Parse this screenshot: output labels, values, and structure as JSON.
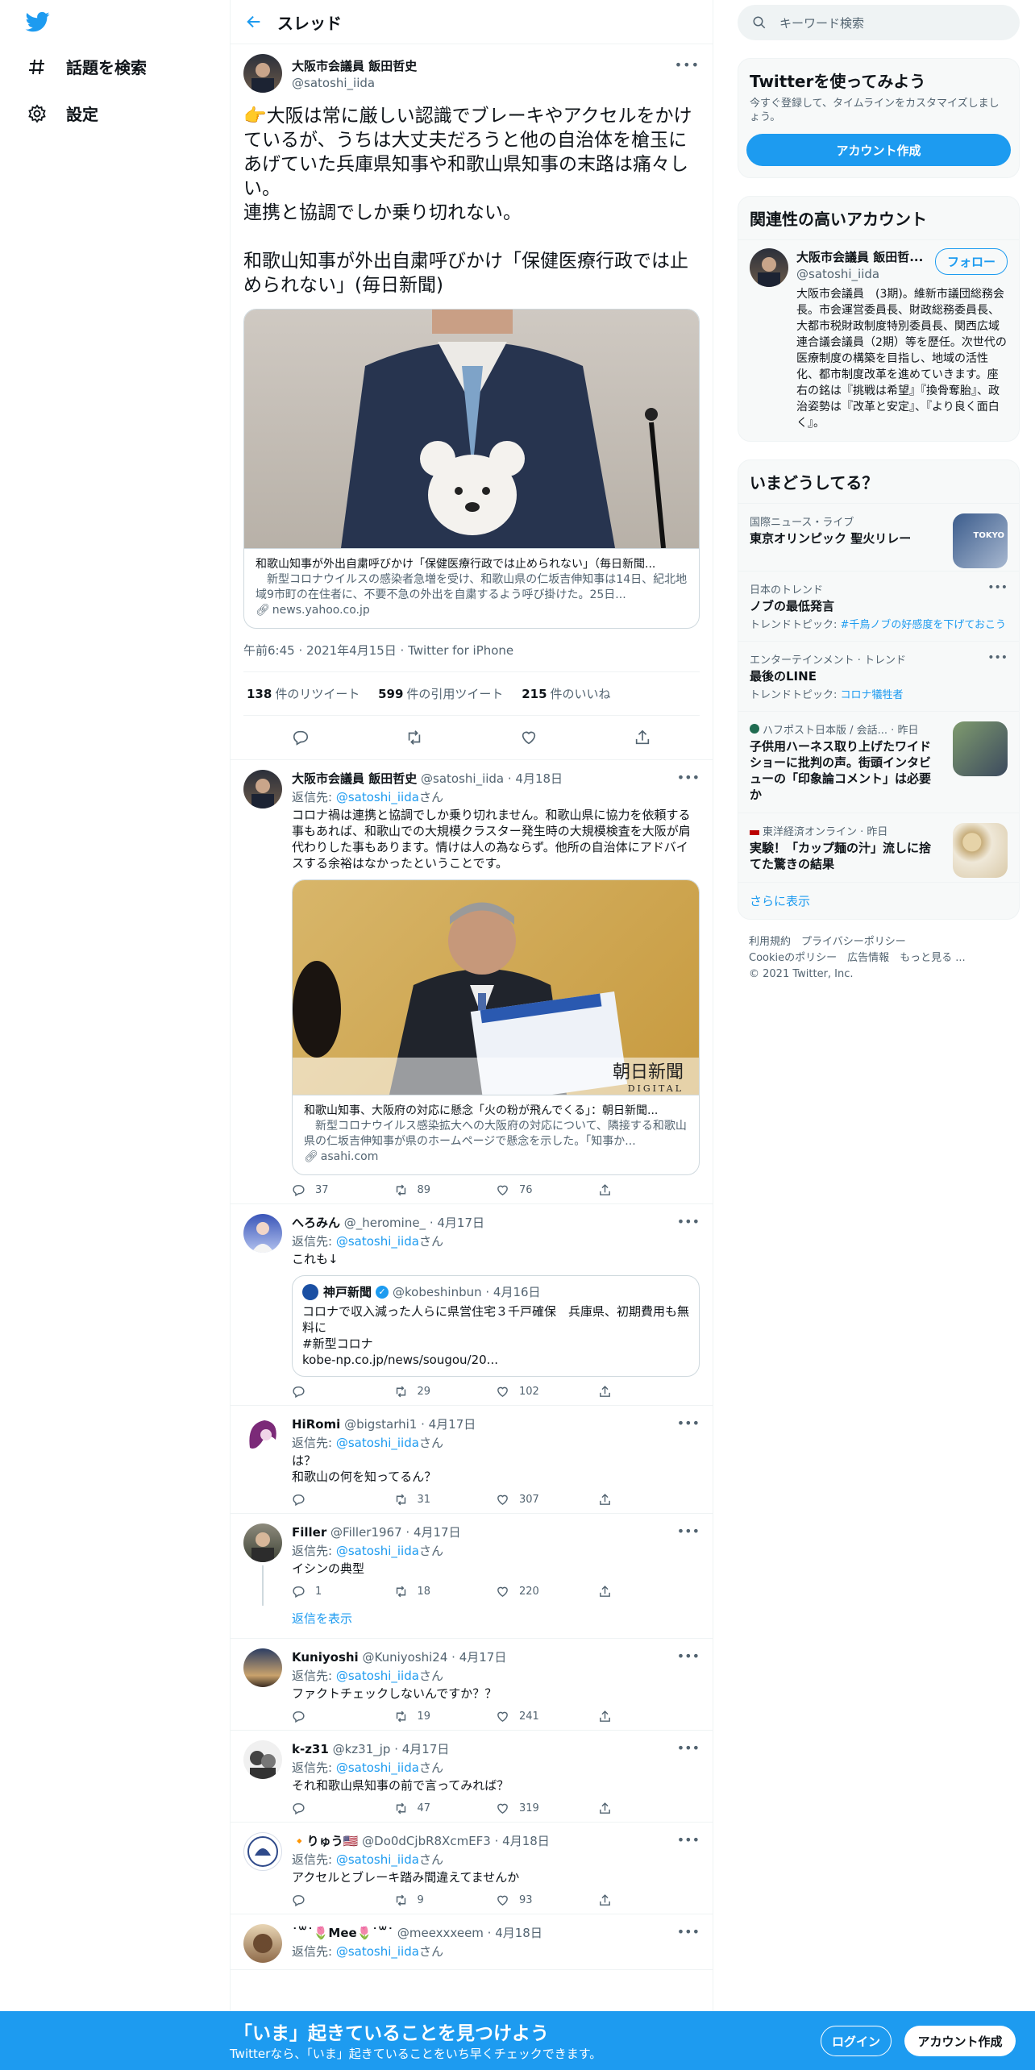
{
  "nav": {
    "explore": "話題を検索",
    "settings": "設定"
  },
  "header": {
    "title": "スレッド"
  },
  "main_tweet": {
    "name": "大阪市会議員 飯田哲史",
    "handle": "@satoshi_iida",
    "text": "👉大阪は常に厳しい認識でブレーキやアクセルをかけているが、うちは大丈夫だろうと他の自治体を槍玉にあげていた兵庫県知事や和歌山県知事の末路は痛々しい。\n連携と協調でしか乗り切れない。\n\n和歌山知事が外出自粛呼びかけ「保健医療行政では止められない」(毎日新聞)",
    "card": {
      "title": "和歌山知事が外出自粛呼びかけ「保健医療行政では止められない」（毎日新聞...",
      "desc": "　新型コロナウイルスの感染者急増を受け、和歌山県の仁坂吉伸知事は14日、紀北地域9市町の在住者に、不要不急の外出を自粛するよう呼び掛けた。25日...",
      "domain": "news.yahoo.co.jp"
    },
    "meta": "午前6:45 · 2021年4月15日 · Twitter for iPhone",
    "retweets": "138",
    "retweets_label": "件のリツイート",
    "quotes": "599",
    "quotes_label": "件の引用ツイート",
    "likes": "215",
    "likes_label": "件のいいね"
  },
  "replies": [
    {
      "name": "大阪市会議員 飯田哲史",
      "handle": "@satoshi_iida · 4月18日",
      "reply_to": "@satoshi_iida",
      "text": "コロナ禍は連携と協調でしか乗り切れません。和歌山県に協力を依頼する事もあれば、和歌山での大規模クラスター発生時の大規模検査を大阪が肩代わりした事もあります。情けは人の為ならず。他所の自治体にアドバイスする余裕はなかったということです。",
      "card": {
        "title": "和歌山知事、大阪府の対応に懸念「火の粉が飛んでくる」：朝日新聞...",
        "desc": "　新型コロナウイルス感染拡大への大阪府の対応について、隣接する和歌山県の仁坂吉伸知事が県のホームページで懸念を示した。「知事か...",
        "domain": "asahi.com",
        "overlay": "朝日新聞",
        "overlay2": "DIGITAL"
      },
      "replies": "37",
      "retweets": "89",
      "likes": "76"
    },
    {
      "name": "へろみん",
      "handle": "@_heromine_ · 4月17日",
      "reply_to": "@satoshi_iida",
      "text": "これも↓",
      "quote": {
        "name": "神戸新聞",
        "handle": "@kobeshinbun · 4月16日",
        "text": "コロナで収入減った人らに県営住宅３千戸確保　兵庫県、初期費用も無料に\n#新型コロナ\nkobe-np.co.jp/news/sougou/20..."
      },
      "replies": "",
      "retweets": "29",
      "likes": "102"
    },
    {
      "name": "HiRomi",
      "handle": "@bigstarhi1 · 4月17日",
      "reply_to": "@satoshi_iida",
      "text": "は？\n和歌山の何を知ってるん？",
      "replies": "",
      "retweets": "31",
      "likes": "307"
    },
    {
      "name": "Filler",
      "handle": "@Filler1967 · 4月17日",
      "reply_to": "@satoshi_iida",
      "text": "イシンの典型",
      "replies": "1",
      "retweets": "18",
      "likes": "220",
      "show_more": "返信を表示"
    },
    {
      "name": "Kuniyoshi",
      "handle": "@Kuniyoshi24 · 4月17日",
      "reply_to": "@satoshi_iida",
      "text": "ファクトチェックしないんですか？？",
      "replies": "",
      "retweets": "19",
      "likes": "241"
    },
    {
      "name": "k-z31",
      "handle": "@kz31_jp · 4月17日",
      "reply_to": "@satoshi_iida",
      "text": "それ和歌山県知事の前で言ってみれば？",
      "replies": "",
      "retweets": "47",
      "likes": "319"
    },
    {
      "name": "🔸りゅう🇺🇸",
      "handle": "@Do0dCjbR8XcmEF3 · 4月18日",
      "reply_to": "@satoshi_iida",
      "text": "アクセルとブレーキ踏み間違えてませんか",
      "replies": "",
      "retweets": "9",
      "likes": "93"
    },
    {
      "name": "˙꒳˙🌷Mee🌷˙꒳˙",
      "handle": "@meexxxeem · 4月18日",
      "reply_to": "@satoshi_iida",
      "text": "",
      "replies": "",
      "retweets": "",
      "likes": ""
    }
  ],
  "reply_prefix": "返信先: ",
  "reply_suffix": "さん",
  "search": {
    "placeholder": "キーワード検索"
  },
  "signup": {
    "title": "Twitterを使ってみよう",
    "sub": "今すぐ登録して、タイムラインをカスタマイズしましょう。",
    "button": "アカウント作成"
  },
  "related": {
    "title": "関連性の高いアカウント",
    "name": "大阪市会議員 飯田哲...",
    "handle": "@satoshi_iida",
    "follow": "フォロー",
    "bio": "大阪市会議員　(3期)。維新市議団総務会長。市会運営委員長、財政総務委員長、大都市税財政制度特別委員長、関西広域連合議会議員（2期）等を歴任。次世代の医療制度の構築を目指し、地域の活性化、都市制度改革を進めていきます。座右の銘は『挑戦は希望』『換骨奪胎』、政治姿勢は『改革と安定』、『より良く面白く』。"
  },
  "trends": {
    "title": "いまどうしてる？",
    "items": [
      {
        "cat": "国際ニュース・ライブ",
        "name": "東京オリンピック 聖火リレー",
        "sub": "",
        "thumb": "TOKYO"
      },
      {
        "cat": "日本のトレンド",
        "name": "ノブの最低発言",
        "sub_prefix": "トレンドトピック: ",
        "sub_link": "#千鳥ノブの好感度を下げておこう"
      },
      {
        "cat": "エンターテインメント · トレンド",
        "name": "最後のLINE",
        "sub_prefix": "トレンドトピック: ",
        "sub_link": "コロナ犠牲者"
      },
      {
        "cat": "ハフポスト日本版 / 会話... · 昨日",
        "name": "子供用ハーネス取り上げたワイドショーに批判の声。街頭インタビューの「印象論コメント」は必要か"
      },
      {
        "cat": "東洋経済オンライン · 昨日",
        "name": "実験！「カップ麺の汁」流しに捨てた驚きの結果"
      }
    ],
    "more": "さらに表示"
  },
  "footer": {
    "l1": "利用規約　プライバシーポリシー",
    "l2": "Cookieのポリシー　広告情報　もっと見る ...",
    "l3": "© 2021 Twitter, Inc."
  },
  "bottom": {
    "title": "「いま」起きていることを見つけよう",
    "sub": "Twitterなら、「いま」起きていることをいち早くチェックできます。",
    "login": "ログイン",
    "signup": "アカウント作成"
  },
  "colors": {
    "accent": "#1d9bf0"
  }
}
